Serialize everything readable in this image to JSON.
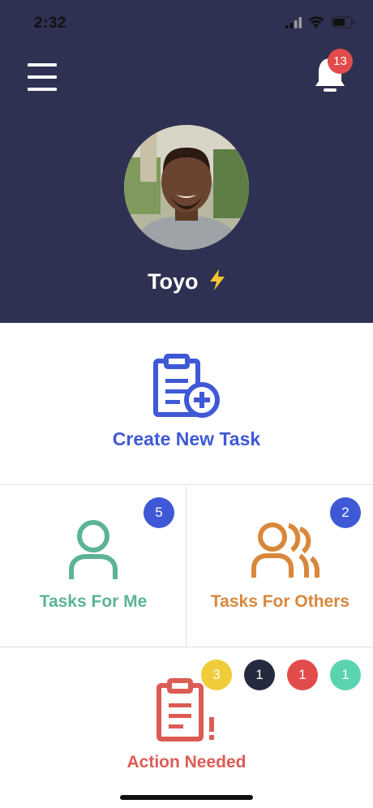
{
  "status_bar": {
    "time": "2:32"
  },
  "header": {
    "notifications_count": "13",
    "user_name": "Toyo",
    "user_emoji": "⚡"
  },
  "create_task": {
    "label": "Create New Task",
    "icon": "clipboard-plus-icon",
    "color": "#3f59d6"
  },
  "tasks_for_me": {
    "label": "Tasks For Me",
    "count": "5",
    "icon": "user-icon",
    "color": "#5bb494",
    "badge_color": "#3f59d6"
  },
  "tasks_for_others": {
    "label": "Tasks For Others",
    "count": "2",
    "icon": "users-icon",
    "color": "#d9873c",
    "badge_color": "#3f59d6"
  },
  "action_needed": {
    "label": "Action Needed",
    "icon": "clipboard-alert-icon",
    "color": "#dc5c55",
    "badges": [
      {
        "count": "3",
        "color": "#f0cc3a"
      },
      {
        "count": "1",
        "color": "#262a3e"
      },
      {
        "count": "1",
        "color": "#e24b4b"
      },
      {
        "count": "1",
        "color": "#5ad4b0"
      }
    ]
  }
}
